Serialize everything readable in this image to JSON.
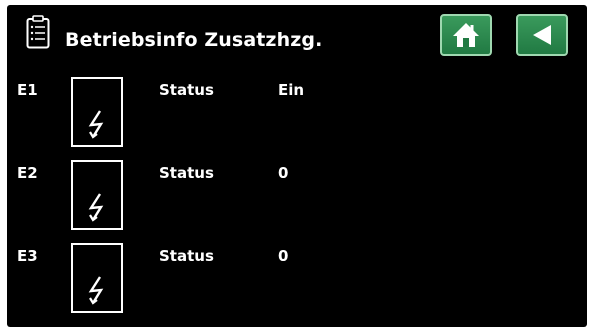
{
  "header": {
    "title": "Betriebsinfo Zusatzhzg.",
    "icon": "clipboard-list-icon",
    "home_icon": "home-icon",
    "back_icon": "back-arrow-icon"
  },
  "heaters": [
    {
      "id": "E1",
      "label": "Status",
      "value": "Ein",
      "icon": "lightning-icon"
    },
    {
      "id": "E2",
      "label": "Status",
      "value": "0",
      "icon": "lightning-icon"
    },
    {
      "id": "E3",
      "label": "Status",
      "value": "0",
      "icon": "lightning-icon"
    }
  ],
  "colors": {
    "background": "#000000",
    "text": "#ffffff",
    "button_green": "#2a8a4e",
    "button_border": "#9fd8b0"
  }
}
